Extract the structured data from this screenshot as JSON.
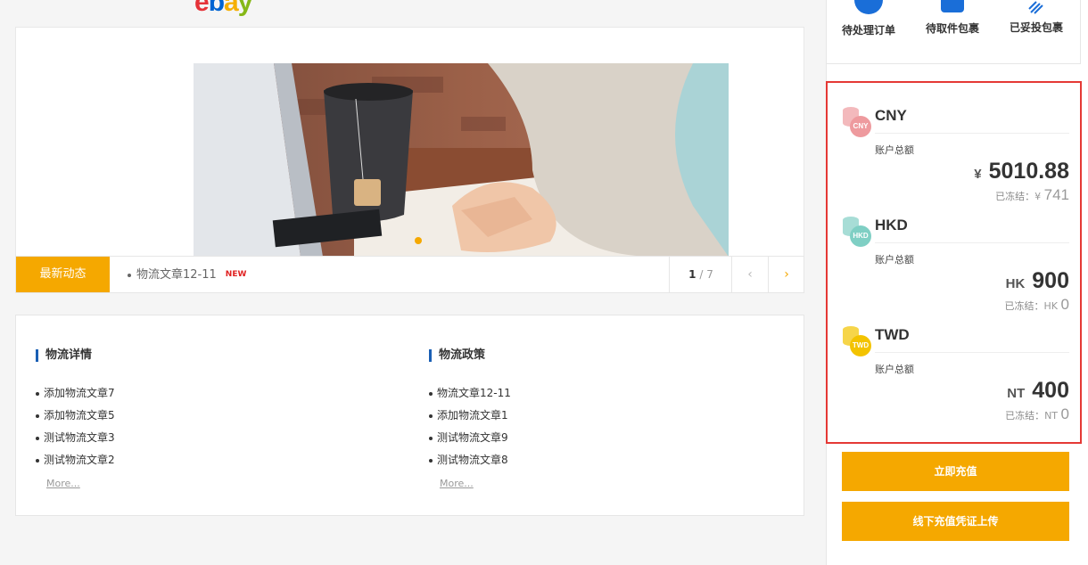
{
  "logo": {
    "text": "ebay",
    "colors": [
      "#e53238",
      "#0064d2",
      "#f5af02",
      "#86b817"
    ]
  },
  "banner": {
    "photo": "laptop-and-tea-photo"
  },
  "news": {
    "label": "最新动态",
    "item": "物流文章12-11",
    "badge": "NEW",
    "page_current": "1",
    "page_total": "/ 7",
    "prev_icon": "‹",
    "next_icon": "›"
  },
  "articles": {
    "left": {
      "title": "物流详情",
      "items": [
        "添加物流文章7",
        "添加物流文章5",
        "测试物流文章3",
        "测试物流文章2"
      ],
      "more": "More..."
    },
    "right": {
      "title": "物流政策",
      "items": [
        "物流文章12-11",
        "添加物流文章1",
        "测试物流文章9",
        "测试物流文章8"
      ],
      "more": "More..."
    }
  },
  "quick_links": [
    {
      "label": "待处理订单",
      "icon": "order-icon"
    },
    {
      "label": "待取件包裹",
      "icon": "package-icon"
    },
    {
      "label": "已妥投包裹",
      "icon": "delivered-icon"
    }
  ],
  "wallet": {
    "currencies": [
      {
        "code": "CNY",
        "badge": "CNY",
        "label": "账户总额",
        "symbol": "¥",
        "amount": "5010.88",
        "frozen_label": "已冻结：",
        "frozen_symbol": "¥",
        "frozen_amount": "741",
        "color": "#ee9a9e"
      },
      {
        "code": "HKD",
        "badge": "HKD",
        "label": "账户总额",
        "symbol": "HK",
        "amount": "900",
        "frozen_label": "已冻结：",
        "frozen_symbol": "HK",
        "frozen_amount": "0",
        "color": "#7fcfc4"
      },
      {
        "code": "TWD",
        "badge": "TWD",
        "label": "账户总额",
        "symbol": "NT",
        "amount": "400",
        "frozen_label": "已冻结：",
        "frozen_symbol": "NT",
        "frozen_amount": "0",
        "color": "#f3c300"
      }
    ]
  },
  "buttons": {
    "recharge": "立即充值",
    "upload": "线下充值凭证上传"
  },
  "colors": {
    "accent": "#f5a800",
    "highlight_border": "#e53935",
    "brand_blue": "#1a6ed8"
  }
}
